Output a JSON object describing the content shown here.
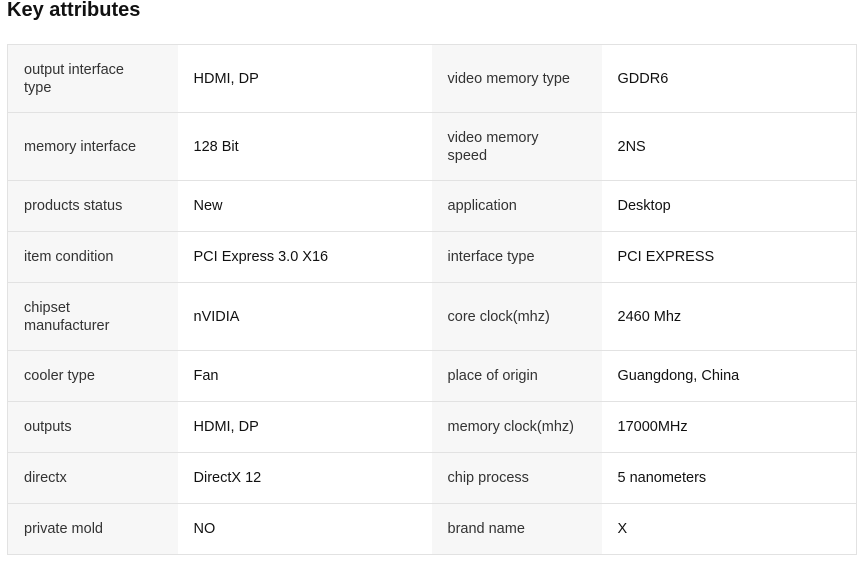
{
  "section": {
    "title": "Key attributes"
  },
  "attributes": [
    {
      "key1": "output interface type",
      "val1": "HDMI, DP",
      "key2": "video memory type",
      "val2": "GDDR6"
    },
    {
      "key1": "memory interface",
      "val1": "128 Bit",
      "key2": "video memory speed",
      "val2": "2NS"
    },
    {
      "key1": "products status",
      "val1": "New",
      "key2": "application",
      "val2": "Desktop"
    },
    {
      "key1": "item condition",
      "val1": "PCI Express 3.0 X16",
      "key2": "interface type",
      "val2": "PCI EXPRESS"
    },
    {
      "key1": "chipset manufacturer",
      "val1": "nVIDIA",
      "key2": "core clock(mhz)",
      "val2": "2460 Mhz"
    },
    {
      "key1": "cooler type",
      "val1": "Fan",
      "key2": "place of origin",
      "val2": "Guangdong, China"
    },
    {
      "key1": "outputs",
      "val1": "HDMI, DP",
      "key2": "memory clock(mhz)",
      "val2": "17000MHz"
    },
    {
      "key1": "directx",
      "val1": "DirectX 12",
      "key2": "chip process",
      "val2": "5 nanometers"
    },
    {
      "key1": "private mold",
      "val1": "NO",
      "key2": "brand name",
      "val2": "X"
    }
  ]
}
